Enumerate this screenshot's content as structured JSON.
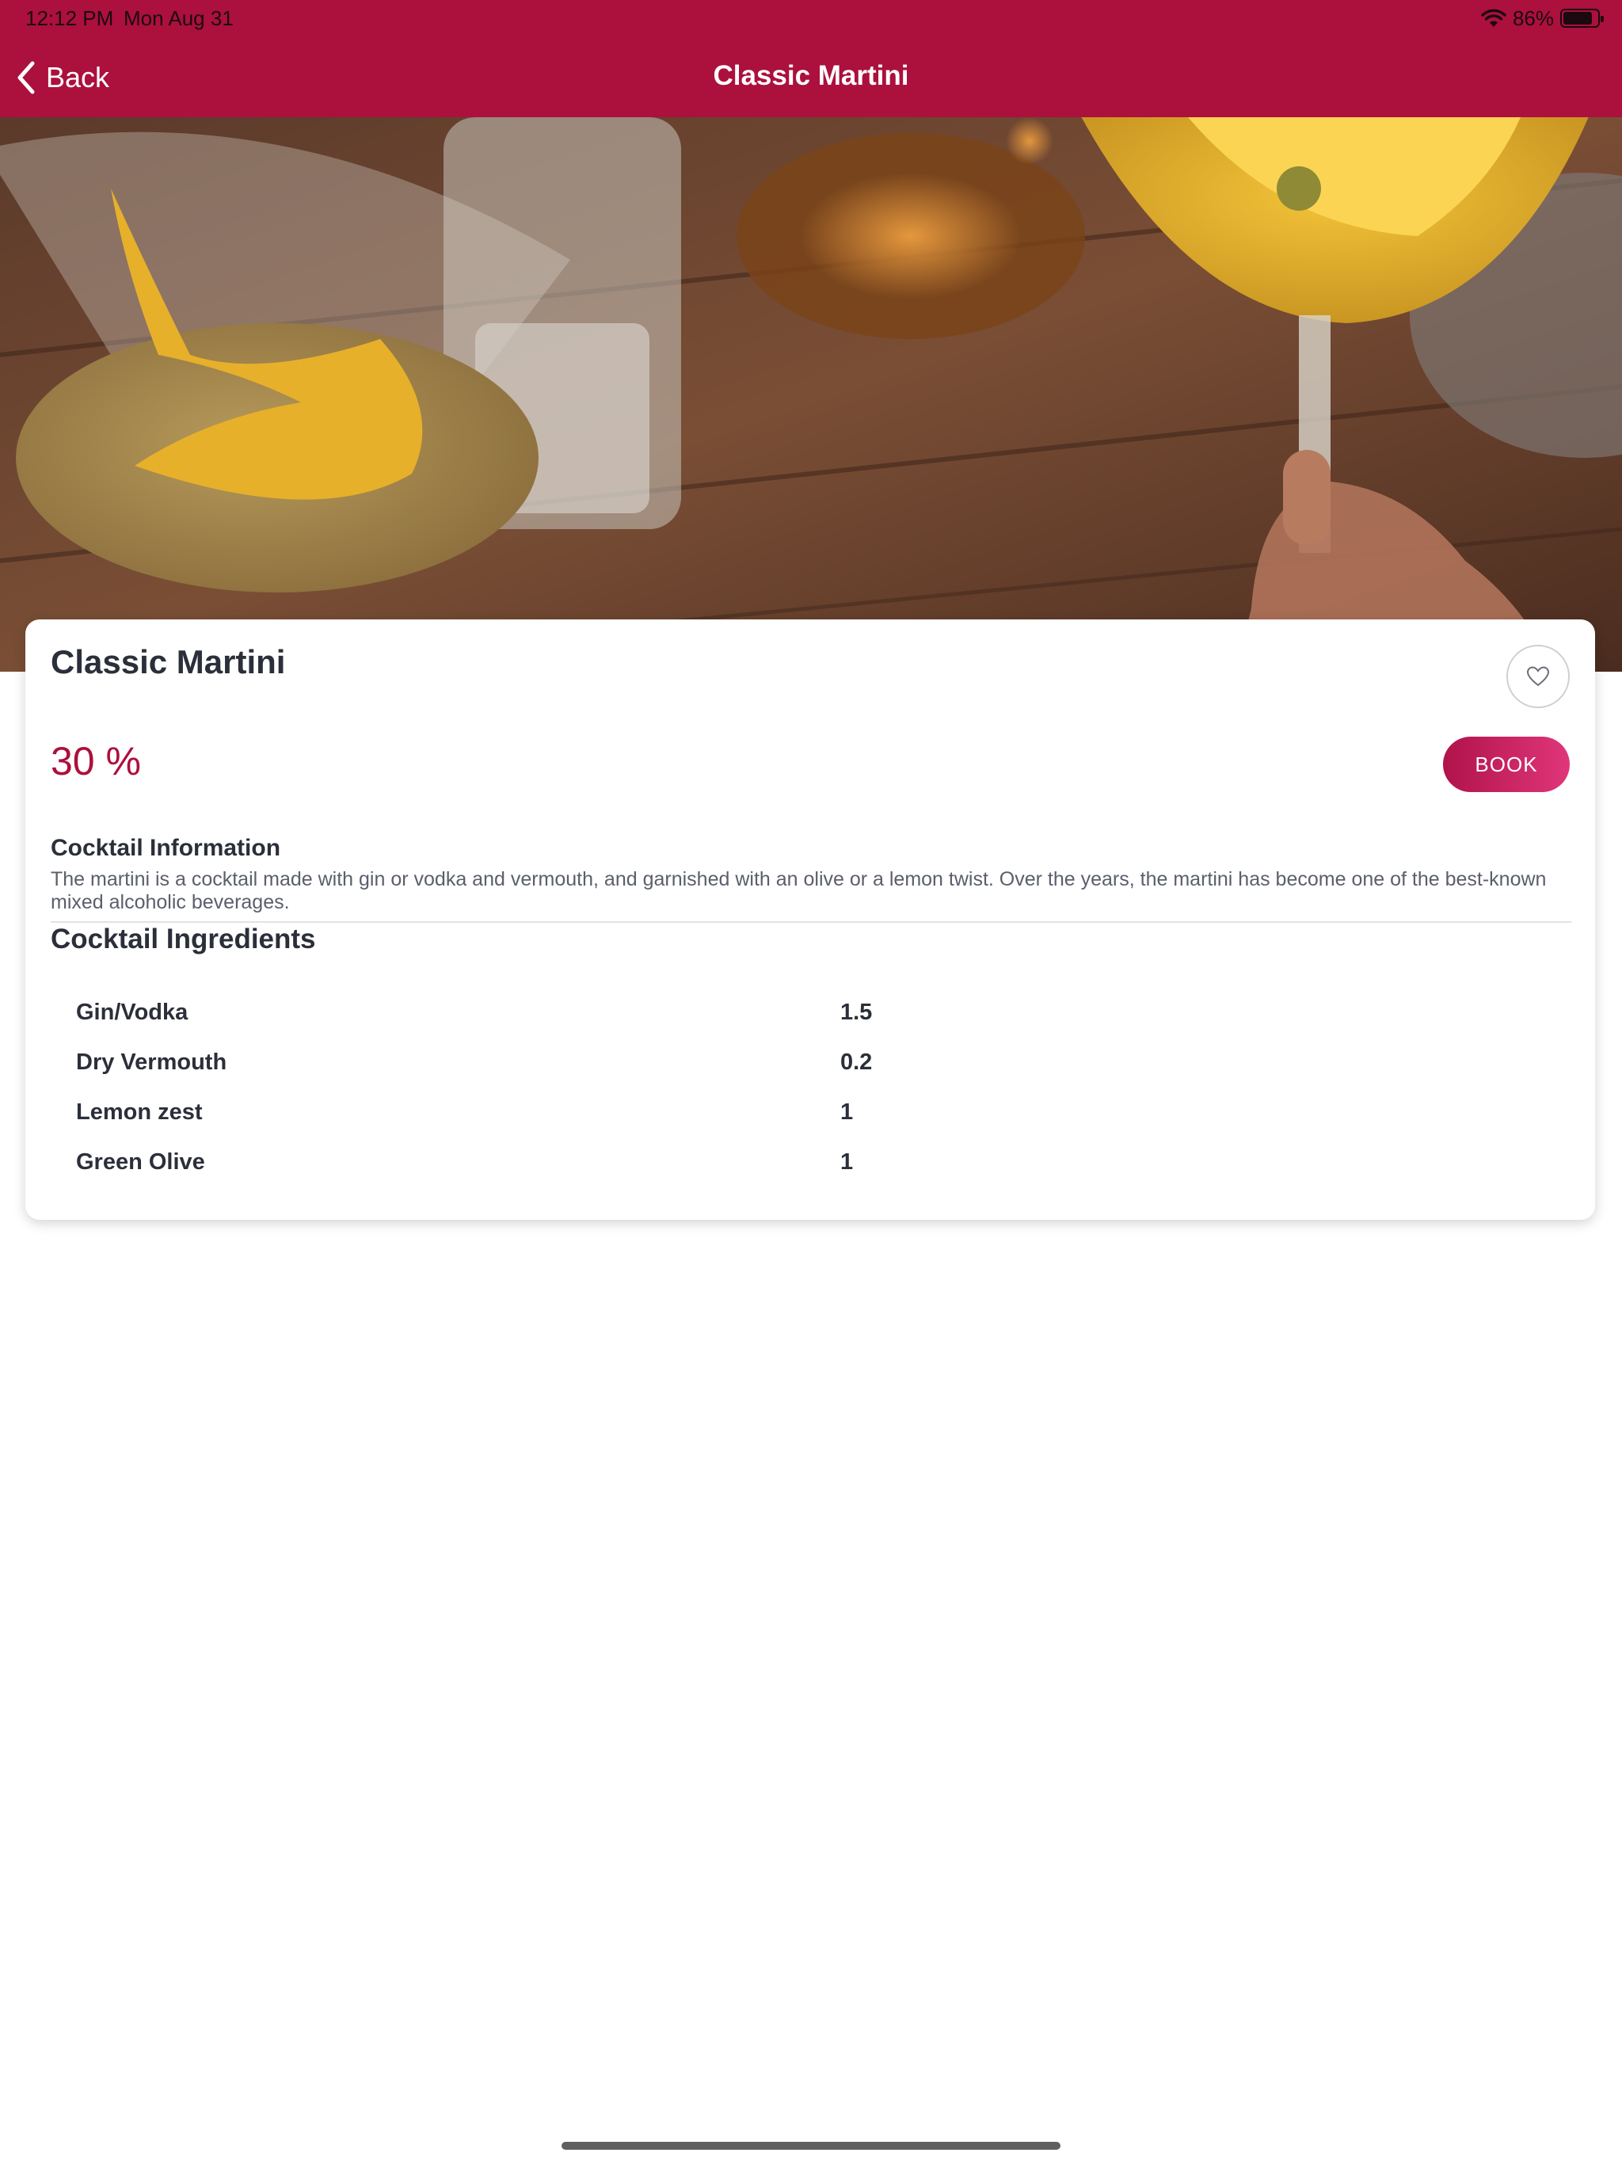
{
  "status_bar": {
    "time": "12:12 PM",
    "date": "Mon Aug 31",
    "battery": "86%",
    "battery_level": 0.86,
    "icons": [
      "wifi-icon",
      "battery-icon"
    ]
  },
  "nav": {
    "back_label": "Back",
    "back_icon": "chevron-left-icon",
    "title": "Classic Martini"
  },
  "hero": {
    "page_count": 1,
    "active_page": 1
  },
  "card": {
    "title": "Classic Martini",
    "favorite_icon": "heart-icon",
    "abv": "30 %",
    "book_label": "BOOK",
    "info_heading": "Cocktail Information",
    "info_text": "The martini is a cocktail made with gin or vodka and vermouth, and garnished with an olive or a lemon twist. Over the years, the martini has become one of the best-known mixed alcoholic beverages.",
    "ingredients_heading": "Cocktail Ingredients",
    "ingredients": [
      {
        "name": "Gin/Vodka",
        "qty": "1.5"
      },
      {
        "name": "Dry Vermouth",
        "qty": "0.2"
      },
      {
        "name": "Lemon zest",
        "qty": "1"
      },
      {
        "name": "Green Olive",
        "qty": "1"
      }
    ]
  },
  "colors": {
    "brand": "#ac103d",
    "accent_gradient_start": "#b0134a",
    "accent_gradient_end": "#e0367a"
  }
}
